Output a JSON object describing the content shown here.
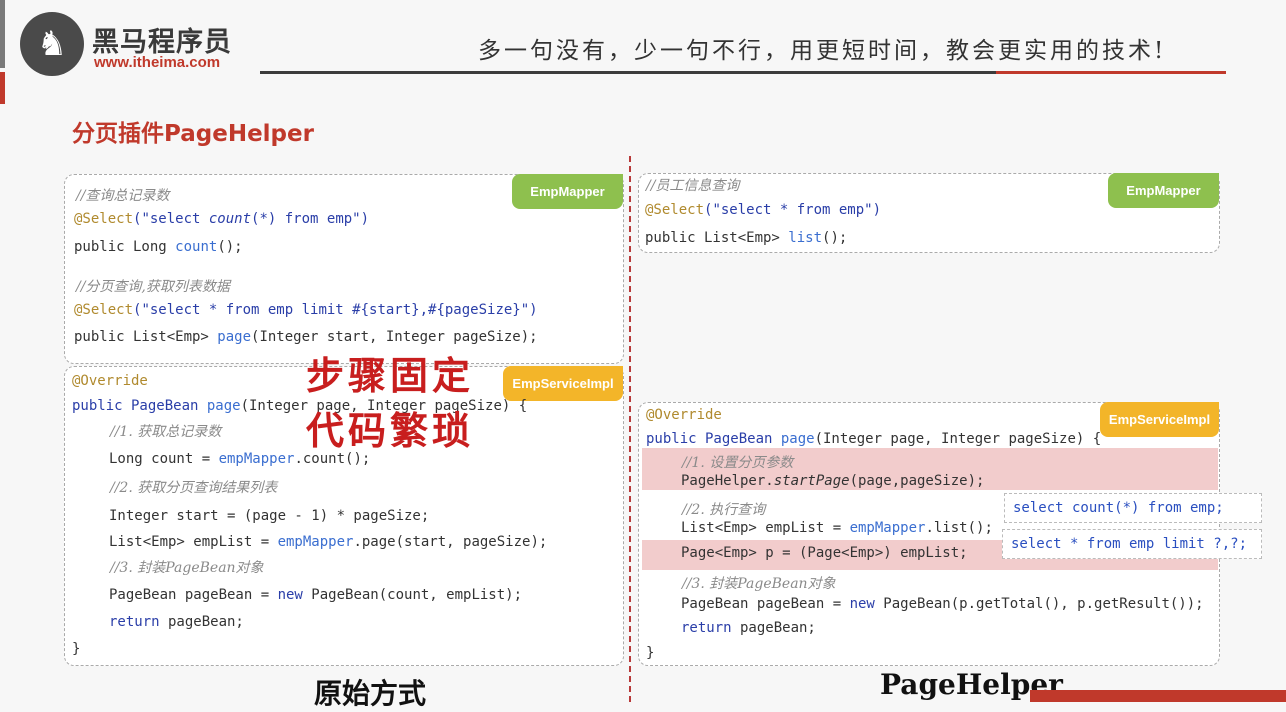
{
  "header": {
    "logo_glyph": "♞",
    "logo_name": "黑马程序员",
    "logo_url": "www.itheima.com",
    "slogan": "多一句没有，少一句不行，用更短时间，教会更实用的技术!"
  },
  "page_title": "分页插件PageHelper",
  "left": {
    "mapper": {
      "tag": "EmpMapper",
      "comment1": "//查询总记录数",
      "ann1": "@Select",
      "sql1_open": "(\"select ",
      "sql1_count": "count",
      "sql1_rest": "(*) from emp\")",
      "line_count_a": "public Long ",
      "line_count_b": "count",
      "line_count_c": "();",
      "comment2": "//分页查询,获取列表数据",
      "ann2": "@Select",
      "sql2": "(\"select * from emp limit #{start},#{pageSize}\")",
      "line_page_a": "public List<Emp> ",
      "line_page_b": "page",
      "line_page_c": "(Integer start, Integer pageSize);"
    },
    "service": {
      "tag": "EmpServiceImpl",
      "override": "@Override",
      "sig_a": "public PageBean ",
      "sig_b": "page",
      "sig_c": "(Integer page, Integer pageSize) {",
      "c1": "//1. 获取总记录数",
      "l1_a": "Long count = ",
      "l1_b": "empMapper",
      "l1_c": ".count();",
      "c2": "//2. 获取分页查询结果列表",
      "l2": "Integer start = (page - 1) * pageSize;",
      "l3_a": "List<Emp> empList = ",
      "l3_b": "empMapper",
      "l3_c": ".page(start, pageSize);",
      "c3": "//3. 封装PageBean对象",
      "l4_a": "PageBean pageBean = ",
      "l4_b": "new",
      "l4_c": " PageBean(count, empList);",
      "l5_a": "return",
      "l5_b": " pageBean;",
      "close": "}"
    },
    "note1": "步骤固定",
    "note2": "代码繁琐",
    "footer": "原始方式"
  },
  "right": {
    "mapper": {
      "tag": "EmpMapper",
      "comment": "//员工信息查询",
      "ann": "@Select",
      "sql": "(\"select * from emp\")",
      "line_a": "public List<Emp> ",
      "line_b": "list",
      "line_c": "();"
    },
    "service": {
      "tag": "EmpServiceImpl",
      "override": "@Override",
      "sig_a": "public PageBean ",
      "sig_b": "page",
      "sig_c": "(Integer page, Integer pageSize) {",
      "c1": "//1. 设置分页参数",
      "l1_a": "PageHelper.",
      "l1_b": "startPage",
      "l1_c": "(page,pageSize);",
      "c2": "//2. 执行查询",
      "l2_a": "List<Emp> empList = ",
      "l2_b": "empMapper",
      "l2_c": ".list();",
      "l3": "Page<Emp> p = (Page<Emp>) empList;",
      "c3": "//3. 封装PageBean对象",
      "l4_a": "PageBean pageBean = ",
      "l4_b": "new",
      "l4_c": " PageBean(p.getTotal(), p.getResult());",
      "l5_a": "return",
      "l5_b": " pageBean;",
      "close": "}"
    },
    "sql_count": "select count(*) from emp;",
    "sql_limit": "select * from emp limit ?,?;",
    "footer": "PageHelper"
  }
}
